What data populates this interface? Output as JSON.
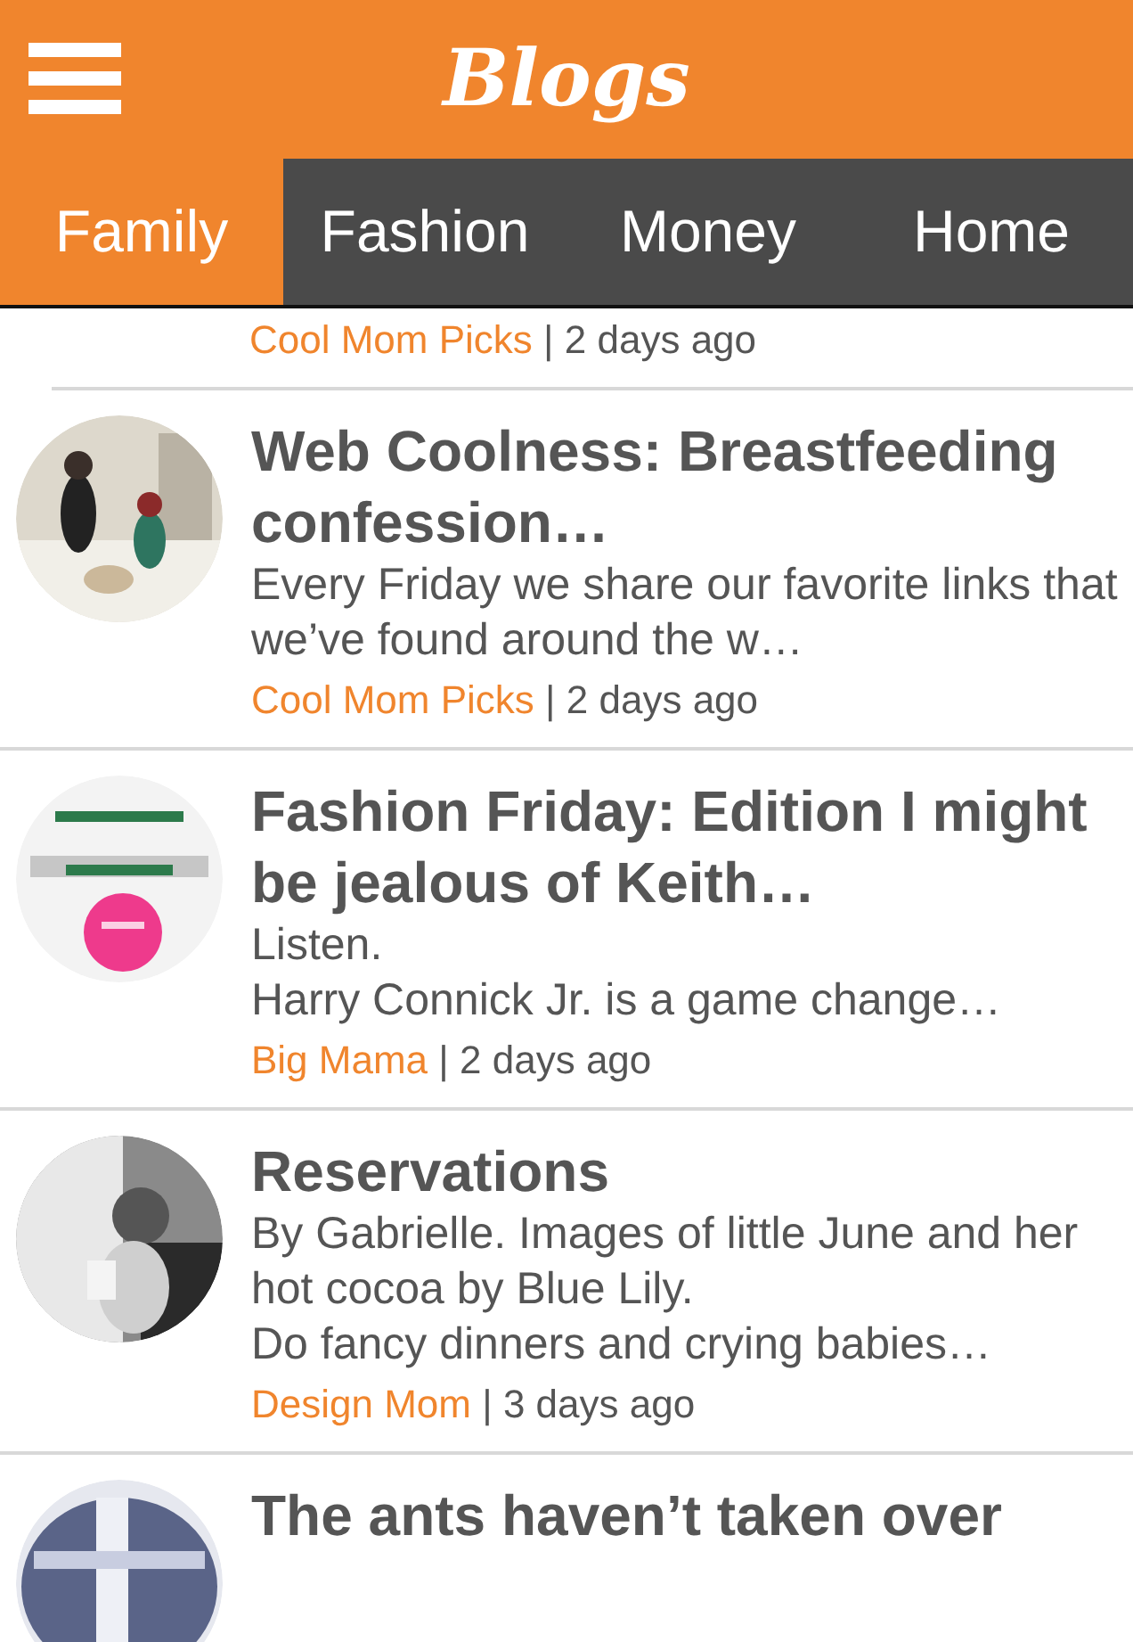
{
  "header": {
    "title": "Blogs"
  },
  "tabs": [
    {
      "label": "Family",
      "selected": true
    },
    {
      "label": "Fashion",
      "selected": false
    },
    {
      "label": "Money",
      "selected": false
    },
    {
      "label": "Home",
      "selected": false
    }
  ],
  "posts": [
    {
      "source": "Cool Mom Picks",
      "separator": "|",
      "time": "2 days ago"
    },
    {
      "title": "Web Coolness: Breastfeeding confession…",
      "paragraphs": [
        "Every Friday we share our favorite links that we’ve found around the w…"
      ],
      "source": "Cool Mom Picks",
      "separator": "|",
      "time": "2 days ago",
      "thumbnail": {
        "kind": "picture"
      }
    },
    {
      "title": "Fashion Friday: Edition I might be jealous of Keith…",
      "paragraphs": [
        "Listen.",
        "Harry Connick Jr. is a game change…"
      ],
      "source": "Big Mama",
      "separator": "|",
      "time": "2 days ago",
      "thumbnail": {
        "kind": "picture"
      }
    },
    {
      "title": "Reservations",
      "paragraphs": [
        "By Gabrielle. Images of little June and her hot cocoa by Blue Lily.",
        "Do fancy dinners and crying babies…"
      ],
      "source": "Design Mom",
      "separator": "|",
      "time": "3 days ago",
      "thumbnail": {
        "kind": "picture"
      }
    },
    {
      "title": "The ants haven’t taken over",
      "thumbnail": {
        "kind": "picture"
      }
    }
  ]
}
